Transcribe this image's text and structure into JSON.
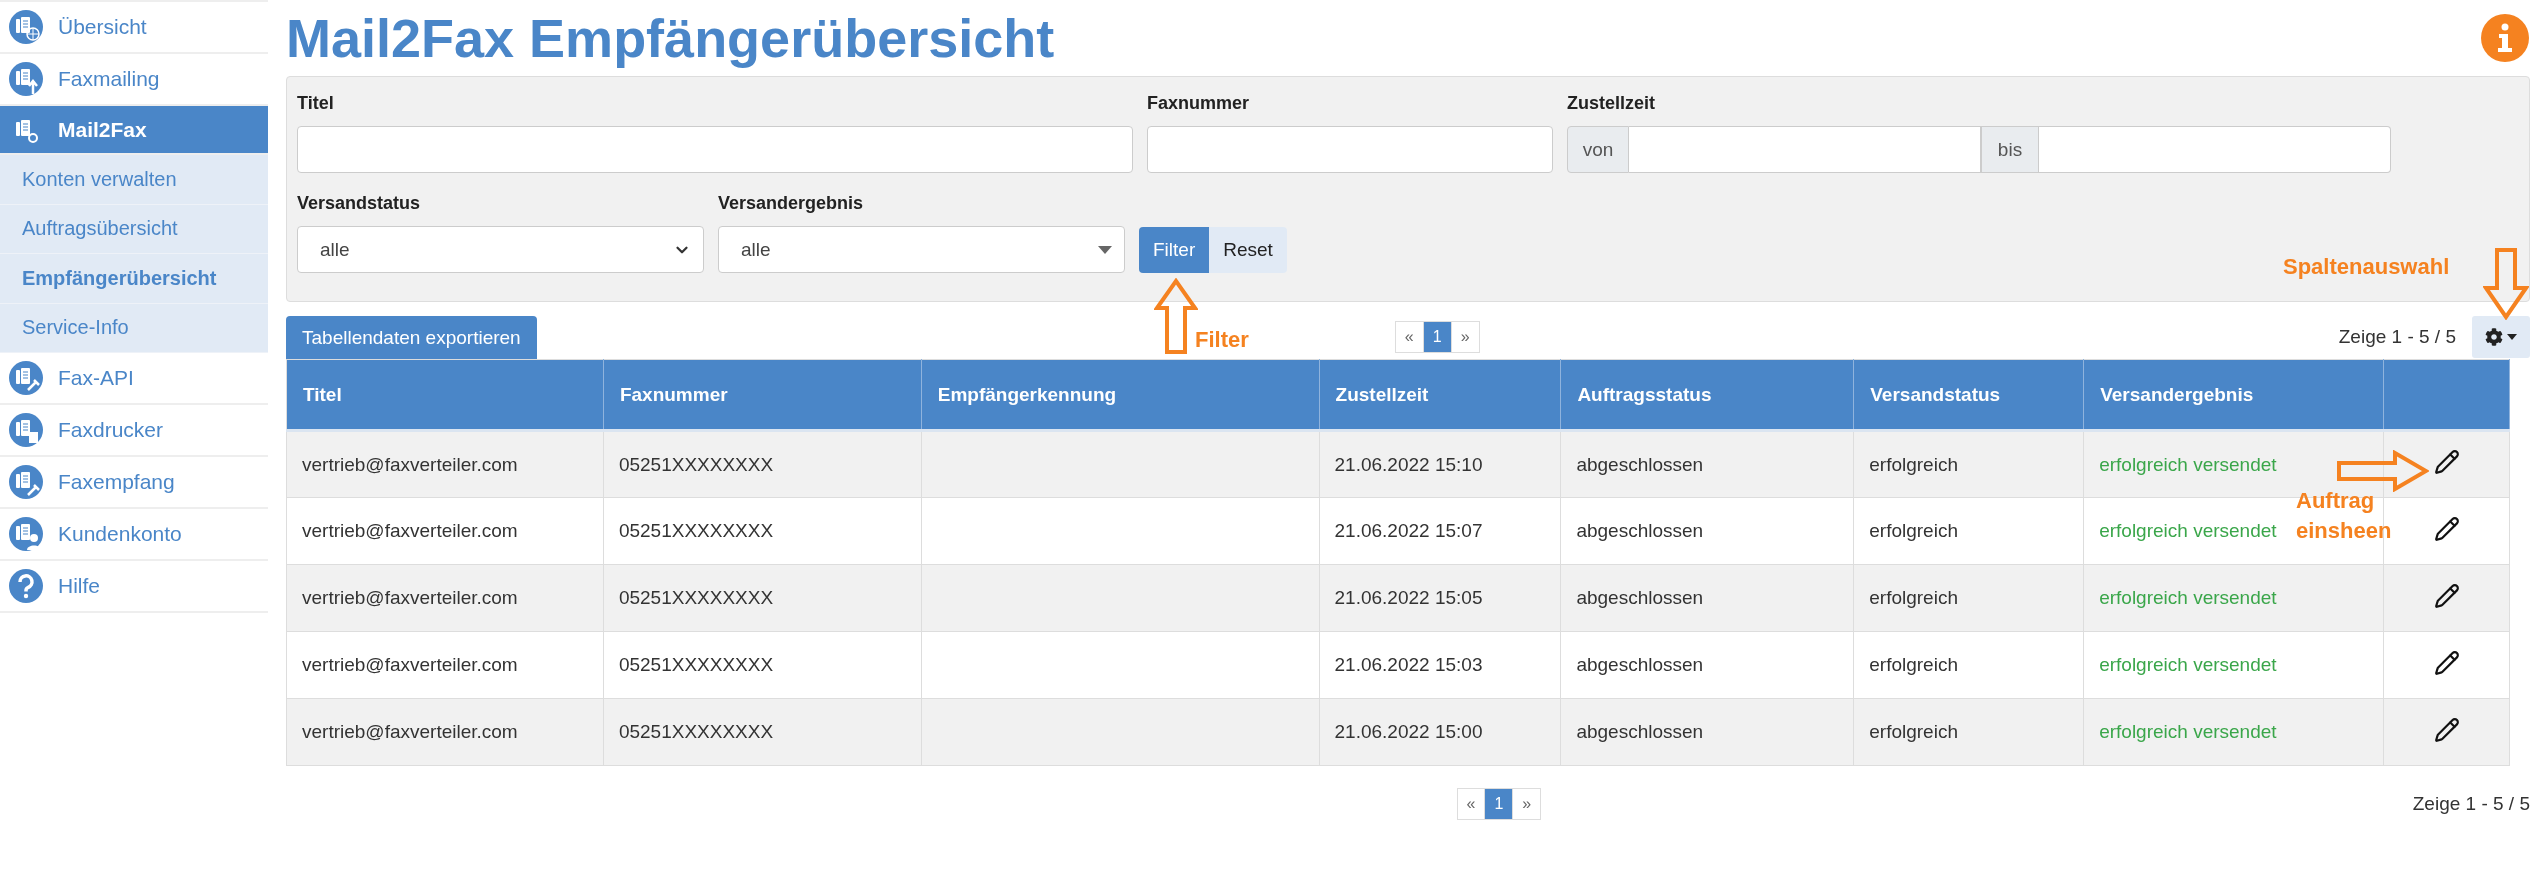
{
  "sidebar": {
    "items": [
      {
        "label": "Übersicht",
        "kind": "overview",
        "selected": false
      },
      {
        "label": "Faxmailing",
        "kind": "mailing",
        "selected": false
      },
      {
        "label": "Mail2Fax",
        "kind": "mail2fax",
        "selected": true,
        "expanded": true,
        "children": [
          {
            "label": "Konten verwalten",
            "selected": false
          },
          {
            "label": "Auftragsübersicht",
            "selected": false
          },
          {
            "label": "Empfängerübersicht",
            "selected": true
          },
          {
            "label": "Service-Info",
            "selected": false
          }
        ]
      },
      {
        "label": "Fax-API",
        "kind": "api",
        "selected": false
      },
      {
        "label": "Faxdrucker",
        "kind": "printer",
        "selected": false
      },
      {
        "label": "Faxempfang",
        "kind": "receive",
        "selected": false
      },
      {
        "label": "Kundenkonto",
        "kind": "account",
        "selected": false
      },
      {
        "label": "Hilfe",
        "kind": "help",
        "selected": false
      }
    ]
  },
  "page_title": "Mail2Fax Empfängerübersicht",
  "filters": {
    "title_label": "Titel",
    "fax_label": "Faxnummer",
    "delivery": {
      "label": "Zustellzeit",
      "from_label": "von",
      "to_label": "bis"
    },
    "selects": [
      {
        "label": "Versandstatus",
        "value": "alle",
        "kind": "chevron"
      },
      {
        "label": "Versandergebnis",
        "value": "alle",
        "kind": "caret"
      }
    ],
    "buttons": [
      {
        "label": "Filter",
        "kind": "primary"
      },
      {
        "label": "Reset",
        "kind": "secondary"
      }
    ]
  },
  "toolbar": {
    "export_button": "Tabellendaten exportieren",
    "pagination": {
      "prev": "«",
      "pages": [
        {
          "label": "1",
          "selected": true
        }
      ],
      "next": "»"
    },
    "count": "Zeige 1 - 5 / 5"
  },
  "table": {
    "columns": [
      "Titel",
      "Faxnummer",
      "Empfängerkennung",
      "Zustellzeit",
      "Auftragsstatus",
      "Versandstatus",
      "Versandergebnis"
    ],
    "rows": [
      {
        "titel": "vertrieb@faxverteiler.com",
        "faxnummer": "05251XXXXXXXX",
        "zustellzeit": "21.06.2022 15:10",
        "auftragsstatus": "abgeschlossen",
        "versandstatus": "erfolgreich",
        "versandergebnis": "erfolgreich versendet",
        "success": true
      },
      {
        "titel": "vertrieb@faxverteiler.com",
        "faxnummer": "05251XXXXXXXX",
        "zustellzeit": "21.06.2022 15:07",
        "auftragsstatus": "abgeschlossen",
        "versandstatus": "erfolgreich",
        "versandergebnis": "erfolgreich versendet",
        "success": true
      },
      {
        "titel": "vertrieb@faxverteiler.com",
        "faxnummer": "05251XXXXXXXX",
        "zustellzeit": "21.06.2022 15:05",
        "auftragsstatus": "abgeschlossen",
        "versandstatus": "erfolgreich",
        "versandergebnis": "erfolgreich versendet",
        "success": true
      },
      {
        "titel": "vertrieb@faxverteiler.com",
        "faxnummer": "05251XXXXXXXX",
        "zustellzeit": "21.06.2022 15:03",
        "auftragsstatus": "abgeschlossen",
        "versandstatus": "erfolgreich",
        "versandergebnis": "erfolgreich versendet",
        "success": true
      },
      {
        "titel": "vertrieb@faxverteiler.com",
        "faxnummer": "05251XXXXXXXX",
        "zustellzeit": "21.06.2022 15:00",
        "auftragsstatus": "abgeschlossen",
        "versandstatus": "erfolgreich",
        "versandergebnis": "erfolgreich versendet",
        "success": true
      }
    ]
  },
  "footer": {
    "pagination": {
      "prev": "«",
      "pages": [
        {
          "label": "1",
          "selected": true
        }
      ],
      "next": "»"
    },
    "count": "Zeige 1 - 5 / 5"
  },
  "annotations": [
    {
      "text": "Filter",
      "kind": "filter"
    },
    {
      "text": "Spaltenauswahl",
      "kind": "columns"
    },
    {
      "text": "Auftrag einsheen",
      "kind": "edit"
    }
  ]
}
